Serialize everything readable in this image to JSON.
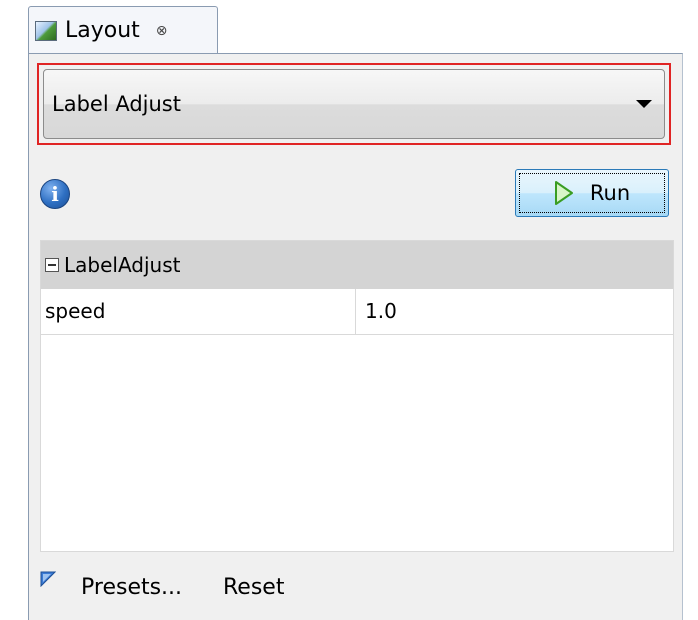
{
  "tab": {
    "title": "Layout",
    "close_glyph": "⊗"
  },
  "layout_selector": {
    "selected": "Label Adjust"
  },
  "run_button": {
    "label": "Run"
  },
  "properties": {
    "group_label": "LabelAdjust",
    "rows": [
      {
        "name": "speed",
        "value": "1.0"
      }
    ]
  },
  "footer": {
    "presets_label": "Presets...",
    "reset_label": "Reset"
  },
  "colors": {
    "highlight_border": "#e02424",
    "run_button_bg": "#bee6fd",
    "info_icon": "#2e6fc2",
    "presets_icon": "#3a7bd5",
    "group_header_bg": "#d4d4d4"
  },
  "icons": {
    "tab": "layout-icon",
    "close": "close-icon",
    "dropdown": "chevron-down-icon",
    "info": "info-icon",
    "run": "play-icon",
    "collapse": "collapse-icon",
    "presets": "presets-triangle-icon"
  }
}
